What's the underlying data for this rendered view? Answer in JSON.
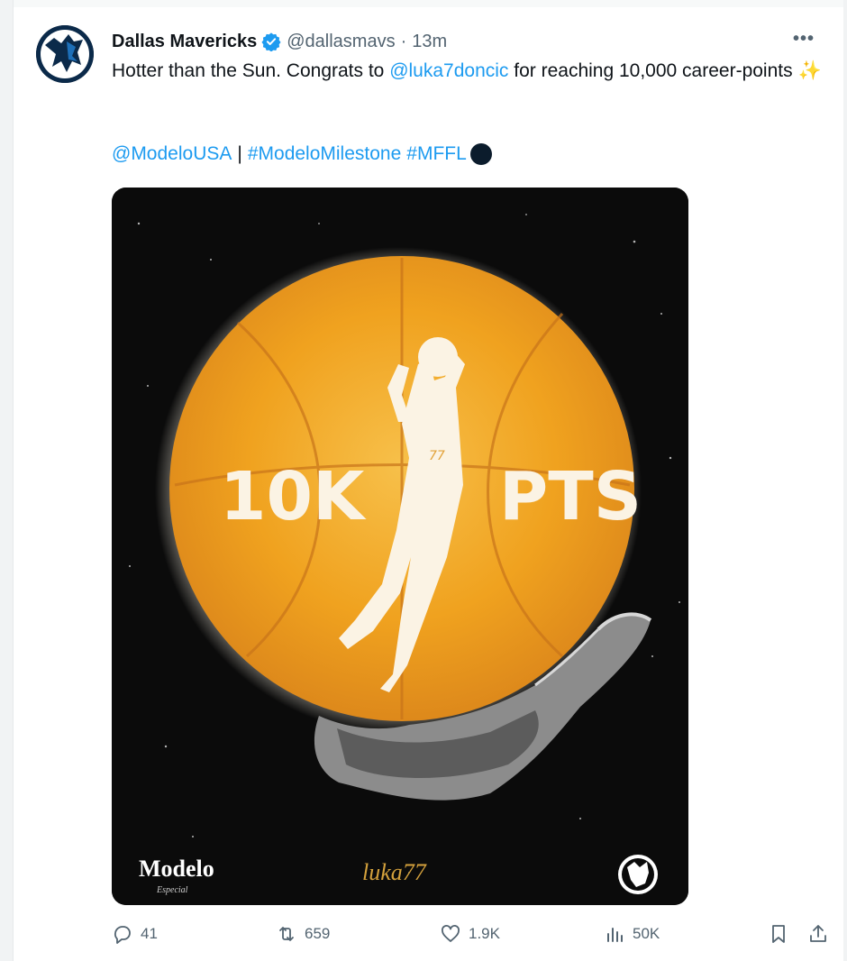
{
  "tweet": {
    "author_name": "Dallas Mavericks",
    "handle": "@dallasmavs",
    "separator": "·",
    "time": "13m",
    "more_label": "•••",
    "text_prefix": "Hotter than the Sun. Congrats to ",
    "mention": "@luka7doncic",
    "text_suffix": " for reaching 10,000 career-points",
    "emoji": "✨",
    "tag_mention": "@ModeloUSA",
    "tag_separator": "|",
    "hashtag_1": "#ModeloMilestone",
    "hashtag_2": "#MFFL"
  },
  "media": {
    "left_text": "10K",
    "right_text": "PTS",
    "jersey_number": "77",
    "sponsor_brand": "Modelo",
    "sponsor_sub": "Especial",
    "signature": "luka77"
  },
  "actions": {
    "replies": "41",
    "reposts": "659",
    "likes": "1.9K",
    "views": "50K"
  },
  "icons": {
    "reply": "reply-icon",
    "repost": "repost-icon",
    "like": "heart-icon",
    "views": "views-icon",
    "bookmark": "bookmark-icon",
    "share": "share-icon",
    "verified": "verified-badge-icon"
  },
  "colors": {
    "link": "#1d9bf0",
    "muted": "#536471",
    "ball": "#f0a21f",
    "background": "#0b0b0b"
  }
}
